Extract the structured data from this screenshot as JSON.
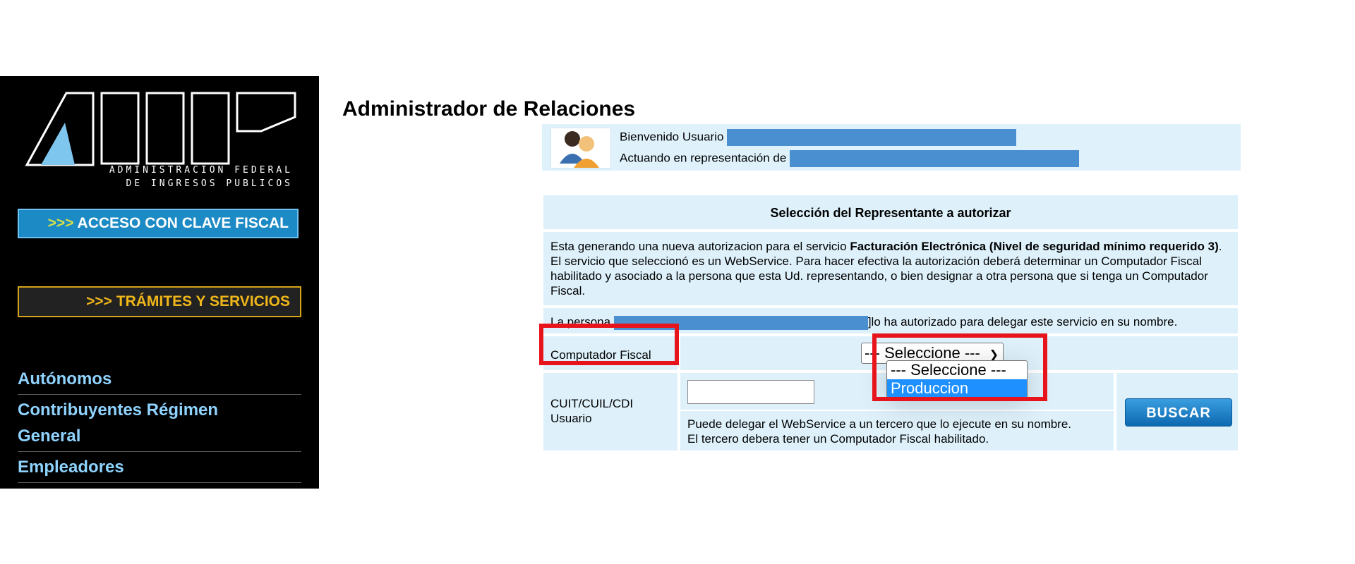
{
  "sidebar": {
    "logo_text": "AFIP",
    "logo_subtitle_line1": "ADMINISTRACION FEDERAL",
    "logo_subtitle_line2": "DE INGRESOS PUBLICOS",
    "btn_clave_arrows": ">>>",
    "btn_clave_label": "ACCESO CON CLAVE FISCAL",
    "btn_tramites_arrows": ">>>",
    "btn_tramites_label": "TRÁMITES Y SERVICIOS",
    "nav": [
      "Autónomos",
      "Contribuyentes Régimen",
      "General",
      "Empleadores"
    ]
  },
  "page": {
    "title": "Administrador de Relaciones"
  },
  "welcome": {
    "line1": "Bienvenido Usuario",
    "line2": "Actuando en representación de"
  },
  "panel": {
    "header": "Selección del Representante a autorizar",
    "desc_pre": "Esta generando una nueva autorizacion para el servicio ",
    "desc_bold": "Facturación Electrónica (Nivel de seguridad mínimo requerido 3)",
    "desc_post": ". El servicio que seleccionó es un WebService. Para hacer efectiva la autorización deberá determinar un Computador Fiscal habilitado y asociado a la persona que esta Ud. representando, o bien designar a otra persona que si tenga un Computador Fiscal.",
    "persona_pre": "La persona",
    "persona_post": "]lo ha autorizado para delegar este servicio en su nombre.",
    "cf_label": "Computador Fiscal",
    "select_value": "--- Seleccione ---",
    "select_options": [
      "--- Seleccione ---",
      "Produccion"
    ],
    "cuit_label_line1": "CUIT/CUIL/CDI",
    "cuit_label_line2": "Usuario",
    "cuit_value": "",
    "help_line1": "Puede delegar el WebService a un tercero que lo ejecute en su nombre.",
    "help_line2": "El tercero debera tener un Computador Fiscal habilitado.",
    "buscar_label": "BUSCAR"
  },
  "colors": {
    "sidebar_bg": "#000000",
    "nav_text": "#8fd3ff",
    "panel_bg": "#def1fb",
    "highlight": "#e8141b",
    "redaction": "#4a8fcf"
  }
}
